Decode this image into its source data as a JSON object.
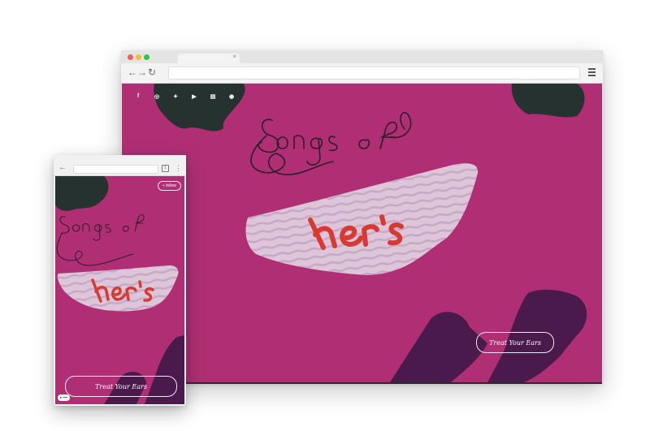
{
  "desktop": {
    "nav": {
      "back_icon": "←",
      "forward_icon": "→",
      "reload_icon": "↻",
      "tab_close": "×"
    },
    "social_icons": [
      {
        "name": "facebook-icon",
        "glyph": "f"
      },
      {
        "name": "instagram-icon",
        "glyph": "◎"
      },
      {
        "name": "twitter-icon",
        "glyph": "✦"
      },
      {
        "name": "youtube-icon",
        "glyph": "▶"
      },
      {
        "name": "bandcamp-icon",
        "glyph": "▤"
      },
      {
        "name": "spotify-icon",
        "glyph": "◉"
      }
    ],
    "title_script": "Songs of",
    "logo_text": "her's",
    "tour_button": "Treat Your Ears"
  },
  "mobile": {
    "back_icon": "←",
    "tabs_icon": "1",
    "more_icon": "⋮",
    "follow_button": "+ follow",
    "title_script": "Songs of",
    "logo_text": "her's",
    "tour_button": "Treat Your Ears"
  },
  "colors": {
    "background": "#b02f74",
    "dark_shape": "#263230",
    "purple_shape": "#4b1a4d",
    "stripe_light": "#dcc6d8",
    "stripe_dark": "#c7a8c8",
    "logo_red": "#d63a32"
  }
}
